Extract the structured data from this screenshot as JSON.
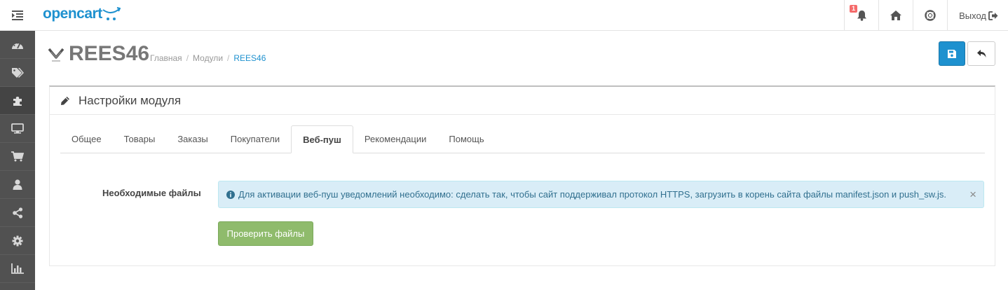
{
  "header": {
    "logo_text": "opencart",
    "notification_count": "1",
    "logout_label": "Выход"
  },
  "sidebar": {
    "items": [
      {
        "icon": "dashboard-icon"
      },
      {
        "icon": "tags-icon"
      },
      {
        "icon": "puzzle-icon"
      },
      {
        "icon": "desktop-icon"
      },
      {
        "icon": "cart-icon"
      },
      {
        "icon": "user-icon"
      },
      {
        "icon": "share-icon"
      },
      {
        "icon": "cog-icon"
      },
      {
        "icon": "bar-chart-icon"
      }
    ]
  },
  "page": {
    "title": "REES46",
    "breadcrumb": [
      "Главная",
      "Модули",
      "REES46"
    ]
  },
  "panel": {
    "title": "Настройки модуля",
    "tabs": [
      "Общее",
      "Товары",
      "Заказы",
      "Покупатели",
      "Веб-пуш",
      "Рекомендации",
      "Помощь"
    ],
    "active_tab": "Веб-пуш",
    "field_label": "Необходимые файлы",
    "alert_text": "Для активации веб-пуш уведомлений необходимо: сделать так, чтобы сайт поддерживал протокол HTTPS, загрузить в корень сайта файлы manifest.json и push_sw.js.",
    "alert_close": "×",
    "check_button": "Проверить файлы"
  },
  "colors": {
    "brand": "#1e91cf",
    "sidebar": "#515151",
    "alert_bg": "#d9edf7",
    "success_btn": "#8fbb6c"
  }
}
